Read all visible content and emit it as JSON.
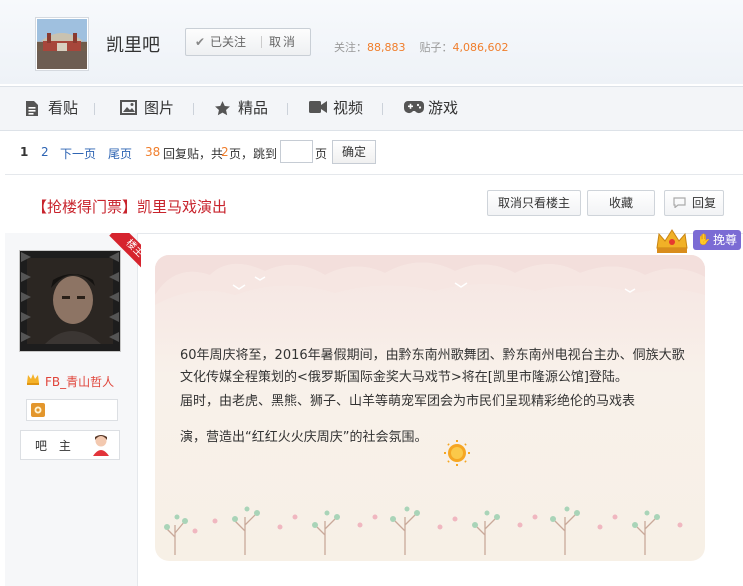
{
  "header": {
    "forum_name": "凯里吧",
    "follow_status": "已关注",
    "unfollow": "取消",
    "stats": {
      "follows_label": "关注：",
      "follows_value": "88,883",
      "posts_label": "贴子：",
      "posts_value": "4,086,602"
    }
  },
  "nav": {
    "items": [
      {
        "label": "看贴",
        "icon": "document-icon"
      },
      {
        "label": "图片",
        "icon": "image-icon"
      },
      {
        "label": "精品",
        "icon": "star-icon"
      },
      {
        "label": "视频",
        "icon": "video-icon"
      },
      {
        "label": "游戏",
        "icon": "gamepad-icon"
      }
    ]
  },
  "pager": {
    "current_page": "1",
    "page_2": "2",
    "next": "下一页",
    "last": "尾页",
    "reply_count": "38",
    "reply_text": "回复贴，共",
    "total_pages": "2",
    "pages_text": "页，跳到",
    "page_unit": "页",
    "confirm": "确定"
  },
  "thread": {
    "title": "【抢楼得门票】凯里马戏演出",
    "buttons": {
      "only_op": "取消只看楼主",
      "favorite": "收藏",
      "reply": "回复"
    },
    "reward_label": "挽尊"
  },
  "author": {
    "badge": "楼主",
    "username": "FB_青山哲人",
    "role": "吧 主"
  },
  "post": {
    "paragraph1": "60年周庆将至，2016年暑假期间，由黔东南州歌舞团、黔东南州电视台主办、侗族大歌文化传媒全程策划的<俄罗斯国际金奖大马戏节>将在[凯里市隆源公馆]登陆。",
    "paragraph2": "届时，由老虎、黑熊、狮子、山羊等萌宠军团会为市民们呈现精彩绝伦的马戏表",
    "paragraph3": "演，营造出“红红火火庆周庆”的社会氛围。",
    "emoji": "sun-icon"
  },
  "colors": {
    "title_red": "#c8232c",
    "link_blue": "#2d64b3",
    "stat_orange": "#f07e2c"
  }
}
